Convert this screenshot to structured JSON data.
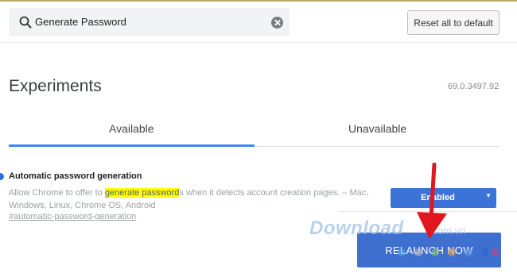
{
  "search": {
    "value": "Generate Password"
  },
  "toolbar": {
    "reset_label": "Reset all to default"
  },
  "page": {
    "title": "Experiments",
    "version": "69.0.3497.92"
  },
  "tabs": [
    {
      "label": "Available",
      "active": true
    },
    {
      "label": "Unavailable",
      "active": false
    }
  ],
  "experiment": {
    "title": "Automatic password generation",
    "desc_before": "Allow Chrome to offer to ",
    "desc_highlight": "generate password",
    "desc_after": "s when it detects account creation pages. – Mac, Windows, Linux, Chrome OS, Android",
    "link": "#automatic-password-generation",
    "state": "Enabled"
  },
  "relaunch_label": "RELAUNCH NOW",
  "watermark": {
    "text": "Download",
    "tail": ".com.vn"
  },
  "colors": {
    "accent": "#4285f4",
    "button": "#3f6fcf",
    "highlight": "#ffff00",
    "arrow": "#e0171e"
  }
}
